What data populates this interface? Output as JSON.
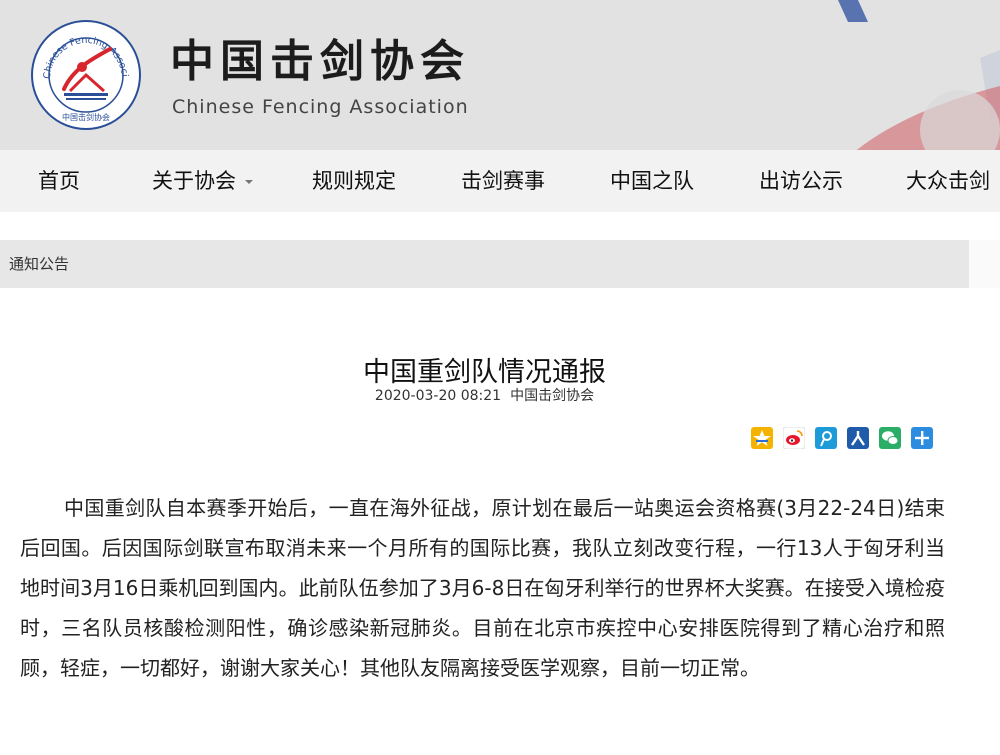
{
  "site": {
    "title": "中国击剑协会",
    "subtitle": "Chinese Fencing Association",
    "logo_ring_text": "Chinese Fencing Association",
    "logo_bottom_text": "中国击剑协会"
  },
  "nav": {
    "items": [
      {
        "label": "首页"
      },
      {
        "label": "关于协会",
        "dropdown": true
      },
      {
        "label": "规则规定"
      },
      {
        "label": "击剑赛事"
      },
      {
        "label": "中国之队"
      },
      {
        "label": "出访公示"
      },
      {
        "label": "大众击剑"
      }
    ]
  },
  "breadcrumb": "通知公告",
  "article": {
    "title": "中国重剑队情况通报",
    "datetime": "2020-03-20 08:21",
    "source": "中国击剑协会",
    "body": "中国重剑队自本赛季开始后，一直在海外征战，原计划在最后一站奥运会资格赛(3月22-24日)结束后回国。后因国际剑联宣布取消未来一个月所有的国际比赛，我队立刻改变行程，一行13人于匈牙利当地时间3月16日乘机回到国内。此前队伍参加了3月6-8日在匈牙利举行的世界杯大奖赛。在接受入境检疫时，三名队员核酸检测阳性，确诊感染新冠肺炎。目前在北京市疾控中心安排医院得到了精心治疗和照顾，轻症，一切都好，谢谢大家关心！其他队友隔离接受医学观察，目前一切正常。"
  },
  "share": {
    "icons": [
      {
        "name": "qzone-share-icon",
        "color": "#f4b300"
      },
      {
        "name": "weibo-share-icon",
        "color": "#e6162d"
      },
      {
        "name": "tencent-weibo-share-icon",
        "color": "#1d9bd8"
      },
      {
        "name": "renren-share-icon",
        "color": "#1f5ba8"
      },
      {
        "name": "wechat-share-icon",
        "color": "#2aae67"
      },
      {
        "name": "more-share-icon",
        "color": "#2c8ce0"
      }
    ]
  },
  "colors": {
    "header_bg": "#e2e2e2",
    "nav_bg": "#f2f2f2",
    "breadcrumb_bg": "#e7e7e7",
    "accent_red": "#d8262e",
    "accent_blue": "#1b4ea0"
  }
}
